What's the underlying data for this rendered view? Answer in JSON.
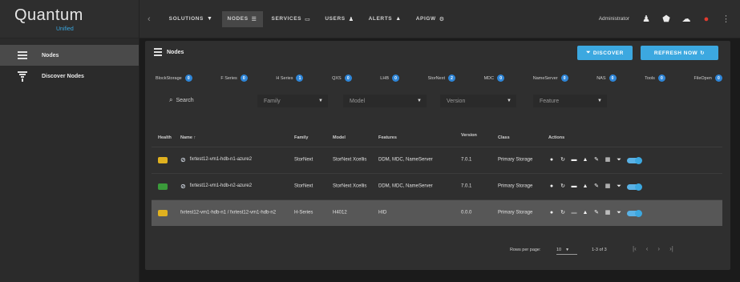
{
  "brand": {
    "name": "Quantum",
    "sub": "Unified"
  },
  "sidebar": {
    "items": [
      {
        "label": "Nodes",
        "active": true
      },
      {
        "label": "Discover Nodes",
        "active": false
      }
    ]
  },
  "topnav": {
    "collapse_glyph": "‹",
    "tabs": [
      {
        "label": "SOLUTIONS",
        "icon": "funnel-icon",
        "glyph": "▼",
        "active": false
      },
      {
        "label": "NODES",
        "icon": "list-icon",
        "glyph": "☰",
        "active": true
      },
      {
        "label": "SERVICES",
        "icon": "monitor-icon",
        "glyph": "▭",
        "active": false
      },
      {
        "label": "USERS",
        "icon": "users-icon",
        "glyph": "♟",
        "active": false
      },
      {
        "label": "ALERTS",
        "icon": "bell-icon",
        "glyph": "▲",
        "active": false
      },
      {
        "label": "APIGW",
        "icon": "gear-icon",
        "glyph": "⚙",
        "active": false
      }
    ],
    "admin_label": "Administrator",
    "icons": [
      {
        "name": "user-icon",
        "glyph": "♟"
      },
      {
        "name": "shield-icon",
        "glyph": "⬟"
      },
      {
        "name": "cloud-icon",
        "glyph": "☁"
      },
      {
        "name": "alert-icon",
        "glyph": "●"
      }
    ],
    "kebab": "⋮"
  },
  "panel": {
    "title": "Nodes",
    "discover_label": "DISCOVER",
    "refresh_label": "REFRESH NOW",
    "refresh_glyph": "↻"
  },
  "chips": [
    {
      "label": "BlockStorage",
      "count": "0"
    },
    {
      "label": "F Series",
      "count": "0"
    },
    {
      "label": "H Series",
      "count": "1"
    },
    {
      "label": "QXS",
      "count": "0"
    },
    {
      "label": "LHB",
      "count": "0"
    },
    {
      "label": "StorNext",
      "count": "2"
    },
    {
      "label": "MDC",
      "count": "0"
    },
    {
      "label": "NameServer",
      "count": "0"
    },
    {
      "label": "NAS",
      "count": "0"
    },
    {
      "label": "Tools",
      "count": "0"
    },
    {
      "label": "FileOpen",
      "count": "0"
    }
  ],
  "filters": {
    "search_placeholder": "Search",
    "search_glyph": "⌕",
    "family": "Family",
    "model": "Model",
    "version": "Version",
    "feature": "Feature",
    "arrow": "▼"
  },
  "table": {
    "headers": {
      "health": "Health",
      "name": "Name ↑",
      "family": "Family",
      "model": "Model",
      "features": "Features",
      "version": "Version",
      "class": "Class",
      "actions": "Actions"
    },
    "rows": [
      {
        "health_color": "#e0b11f",
        "link_glyph": "⊘",
        "name": "fxrtest12-vm1-hdb-n1-azure2",
        "family": "StorNext",
        "model": "StorNext Xcellis",
        "features": "DDM, MDC, NameServer",
        "version": "7.0.1",
        "class": "Primary Storage",
        "selected": false
      },
      {
        "health_color": "#3a9a3a",
        "link_glyph": "⊘",
        "name": "fxrtest12-vm1-hdb-n2-azure2",
        "family": "StorNext",
        "model": "StorNext Xcellis",
        "features": "DDM, MDC, NameServer",
        "version": "7.0.1",
        "class": "Primary Storage",
        "selected": false
      },
      {
        "health_color": "#e0b11f",
        "link_glyph": "",
        "name": "fxrtest12-vm1-hdb-n1 / fxrtest12-vm1-hdb-n2",
        "family": "H-Series",
        "model": "H4012",
        "features": "HID",
        "version": "0.0.0",
        "class": "Primary Storage",
        "selected": true
      }
    ],
    "action_icons": [
      {
        "name": "info-icon",
        "glyph": "●"
      },
      {
        "name": "refresh-icon",
        "glyph": "↻"
      },
      {
        "name": "card-icon",
        "glyph": "▬"
      },
      {
        "name": "bell-icon",
        "glyph": "▲"
      },
      {
        "name": "edit-icon",
        "glyph": "✎"
      },
      {
        "name": "chart-icon",
        "glyph": "▦"
      },
      {
        "name": "filter-icon",
        "glyph": "⏷"
      }
    ]
  },
  "footer": {
    "rows_per_page_label": "Rows per page:",
    "rows_per_page": "10",
    "arrow": "▼",
    "range": "1-3 of 3",
    "pager": [
      "|‹",
      "‹",
      "›",
      "›|"
    ]
  }
}
